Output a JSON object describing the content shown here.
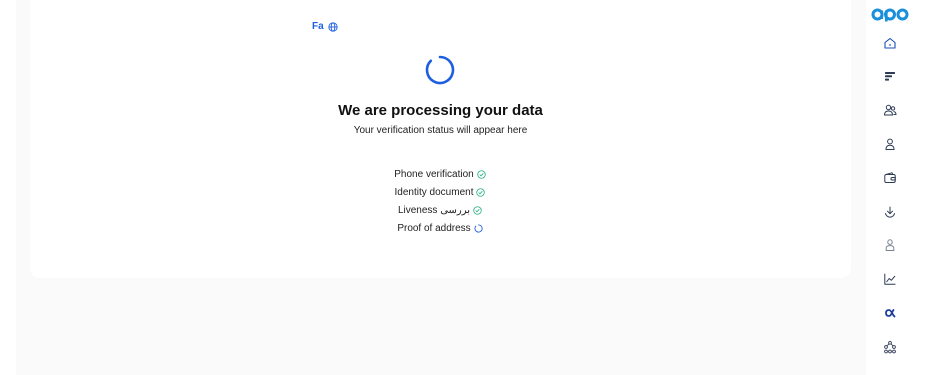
{
  "language": {
    "label": "Fa",
    "icon": "globe-icon"
  },
  "main": {
    "title": "We are processing your data",
    "subtitle": "Your verification status will appear here"
  },
  "steps": [
    {
      "label": "Phone verification",
      "status": "complete",
      "icon": "check-circle-icon"
    },
    {
      "label": "Identity document",
      "status": "complete",
      "icon": "check-circle-icon"
    },
    {
      "label": "Liveness بررسی",
      "status": "complete",
      "icon": "check-circle-icon"
    },
    {
      "label": "Proof of address",
      "status": "pending",
      "icon": "spinner-icon"
    }
  ],
  "sidebar": {
    "items": [
      {
        "icon": "home-icon"
      },
      {
        "icon": "lines-icon"
      },
      {
        "icon": "users-icon"
      },
      {
        "icon": "user-icon"
      },
      {
        "icon": "wallet-icon"
      },
      {
        "icon": "download-icon"
      },
      {
        "icon": "user-outline-icon"
      },
      {
        "icon": "chart-icon"
      },
      {
        "icon": "alpha-icon"
      },
      {
        "icon": "network-icon"
      }
    ]
  },
  "colors": {
    "accent": "#1d5fe0",
    "success": "#22b07d",
    "logo": "#1a8fdc"
  }
}
